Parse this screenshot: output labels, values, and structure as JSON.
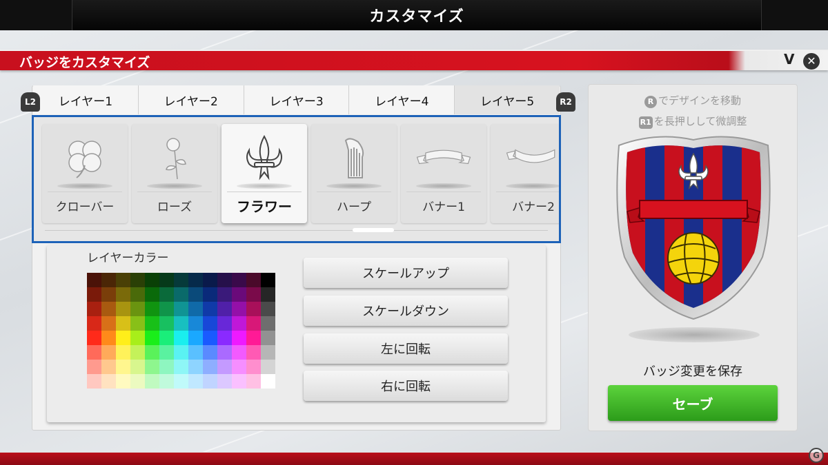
{
  "header": {
    "title": "カスタマイズ"
  },
  "subheader": {
    "title": "バッジをカスタマイズ",
    "v_label": "V",
    "close_symbol": "✕"
  },
  "shoulder": {
    "left": "L2",
    "right": "R2"
  },
  "tabs": [
    {
      "label": "レイヤー1"
    },
    {
      "label": "レイヤー2"
    },
    {
      "label": "レイヤー3"
    },
    {
      "label": "レイヤー4"
    },
    {
      "label": "レイヤー5",
      "selected": true
    }
  ],
  "layer_items": [
    {
      "label": "クローバー",
      "icon": "clover-icon"
    },
    {
      "label": "ローズ",
      "icon": "rose-icon"
    },
    {
      "label": "フラワー",
      "icon": "fleur-de-lis-icon",
      "selected": true
    },
    {
      "label": "ハープ",
      "icon": "harp-icon"
    },
    {
      "label": "バナー1",
      "icon": "banner-icon"
    },
    {
      "label": "バナー2",
      "icon": "banner-icon"
    }
  ],
  "color_section": {
    "label": "レイヤーカラー",
    "palette": [
      [
        "#4a1208",
        "#4a2606",
        "#4a4006",
        "#2a4006",
        "#0a4006",
        "#063a1a",
        "#063a3a",
        "#062a4a",
        "#0a1a4a",
        "#26104a",
        "#3a0a4a",
        "#4a0a2a",
        "#000000"
      ],
      [
        "#7a1a0a",
        "#7a3e0a",
        "#7a6a0a",
        "#4a6a0a",
        "#0a6a0a",
        "#0a6a3a",
        "#0a6a6a",
        "#0a4a7a",
        "#0a2a7a",
        "#3a1a7a",
        "#6a0a7a",
        "#7a0a4a",
        "#262626"
      ],
      [
        "#a82010",
        "#a85a10",
        "#a89410",
        "#6a9410",
        "#109410",
        "#10944a",
        "#109494",
        "#106aa8",
        "#103aa8",
        "#5020a8",
        "#9410a8",
        "#a8105a",
        "#4a4a4a"
      ],
      [
        "#d82818",
        "#d87018",
        "#d8c018",
        "#88c018",
        "#18c018",
        "#18c060",
        "#18c0c0",
        "#1888d8",
        "#1848d8",
        "#6828d8",
        "#c018d8",
        "#d81878",
        "#6e6e6e"
      ],
      [
        "#ff2a1a",
        "#ff8a1a",
        "#ffee1a",
        "#a8ee1a",
        "#1aee1a",
        "#1aee7a",
        "#1aeeee",
        "#1aa8ff",
        "#1a5aff",
        "#8a2aff",
        "#ee1aff",
        "#ff1a96",
        "#929292"
      ],
      [
        "#ff6a5a",
        "#ffaa5a",
        "#fff25a",
        "#c4f25a",
        "#5af25a",
        "#5af2a0",
        "#5af2f2",
        "#5ac0ff",
        "#5a8aff",
        "#aa6aff",
        "#f25aff",
        "#ff5ab4",
        "#b6b6b6"
      ],
      [
        "#ff9a8e",
        "#ffc88e",
        "#fff68e",
        "#d8f68e",
        "#8ef68e",
        "#8ef6c0",
        "#8ef6f6",
        "#8ed4ff",
        "#8eaeff",
        "#c49aff",
        "#f68eff",
        "#ff8ece",
        "#d4d4d4"
      ],
      [
        "#ffc8c0",
        "#ffe2c0",
        "#fffac0",
        "#ecfac0",
        "#c0fac0",
        "#c0fadc",
        "#c0fafa",
        "#c0e8ff",
        "#c0d4ff",
        "#dcc8ff",
        "#fac0ff",
        "#ffc0e4",
        "#ffffff"
      ]
    ]
  },
  "actions": [
    {
      "label": "スケールアップ"
    },
    {
      "label": "スケールダウン"
    },
    {
      "label": "左に回転"
    },
    {
      "label": "右に回転"
    }
  ],
  "preview": {
    "hint1_key": "R",
    "hint1": "でデザインを移動",
    "hint2_key": "R1",
    "hint2": "を長押しして微調整",
    "save_label": "バッジ変更を保存",
    "save_button": "セーブ"
  },
  "watermark": "G",
  "colors": {
    "accent_red": "#d7121f",
    "selection_blue": "#1d62b8",
    "save_green": "#3cb224",
    "badge_red": "#c8101e",
    "badge_blue": "#1a2f8c"
  }
}
